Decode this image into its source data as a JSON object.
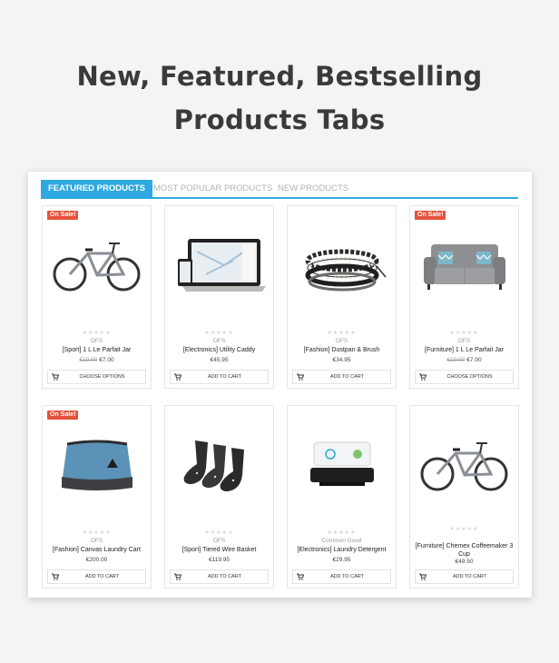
{
  "headline": {
    "line1": "New, Featured, Bestselling",
    "line2": "Products Tabs"
  },
  "tabs": [
    {
      "label": "FEATURED PRODUCTS",
      "active": true
    },
    {
      "label": "MOST POPULAR PRODUCTS",
      "active": false
    },
    {
      "label": "NEW PRODUCTS",
      "active": false
    }
  ],
  "colors": {
    "accent": "#2ea8e0",
    "sale_badge": "#e5533d",
    "page_bg": "#f3f4f6"
  },
  "products": [
    {
      "sale": "On Sale!",
      "brand": "OFS",
      "title": "[Sport] 1 L Le Parfait Jar",
      "old_price": "€10.00",
      "price": "€7.00",
      "button": "CHOOSE OPTIONS",
      "image": "bicycle-image"
    },
    {
      "sale": "",
      "brand": "OFS",
      "title": "[Electronics] Utility Caddy",
      "old_price": "",
      "price": "€45.95",
      "button": "ADD TO CART",
      "image": "laptop-phone-image"
    },
    {
      "sale": "",
      "brand": "OFS",
      "title": "[Fashion] Dustpan & Brush",
      "old_price": "",
      "price": "€34.95",
      "button": "ADD TO CART",
      "image": "bracelets-image"
    },
    {
      "sale": "On Sale!",
      "brand": "OFS",
      "title": "[Furniture] 1 L Le Parfait Jar",
      "old_price": "€10.00",
      "price": "€7.00",
      "button": "CHOOSE OPTIONS",
      "image": "sofa-image"
    },
    {
      "sale": "On Sale!",
      "brand": "OFS",
      "title": "[Fashion] Canvas Laundry Cart",
      "old_price": "",
      "price": "€200.00",
      "button": "ADD TO CART",
      "image": "toiletry-bag-image"
    },
    {
      "sale": "",
      "brand": "OFS",
      "title": "[Sport] Tiered Wire Basket",
      "old_price": "",
      "price": "€119.95",
      "button": "ADD TO CART",
      "image": "socks-image"
    },
    {
      "sale": "",
      "brand": "Common Good",
      "title": "[Electronics] Laundry Detergent",
      "old_price": "",
      "price": "€29.95",
      "button": "ADD TO CART",
      "image": "hud-device-image"
    },
    {
      "sale": "",
      "brand": "",
      "title": "[Furniture] Chemex Coffeemaker 3 Cup",
      "old_price": "",
      "price": "€49.50",
      "button": "ADD TO CART",
      "image": "bicycle-image"
    }
  ]
}
